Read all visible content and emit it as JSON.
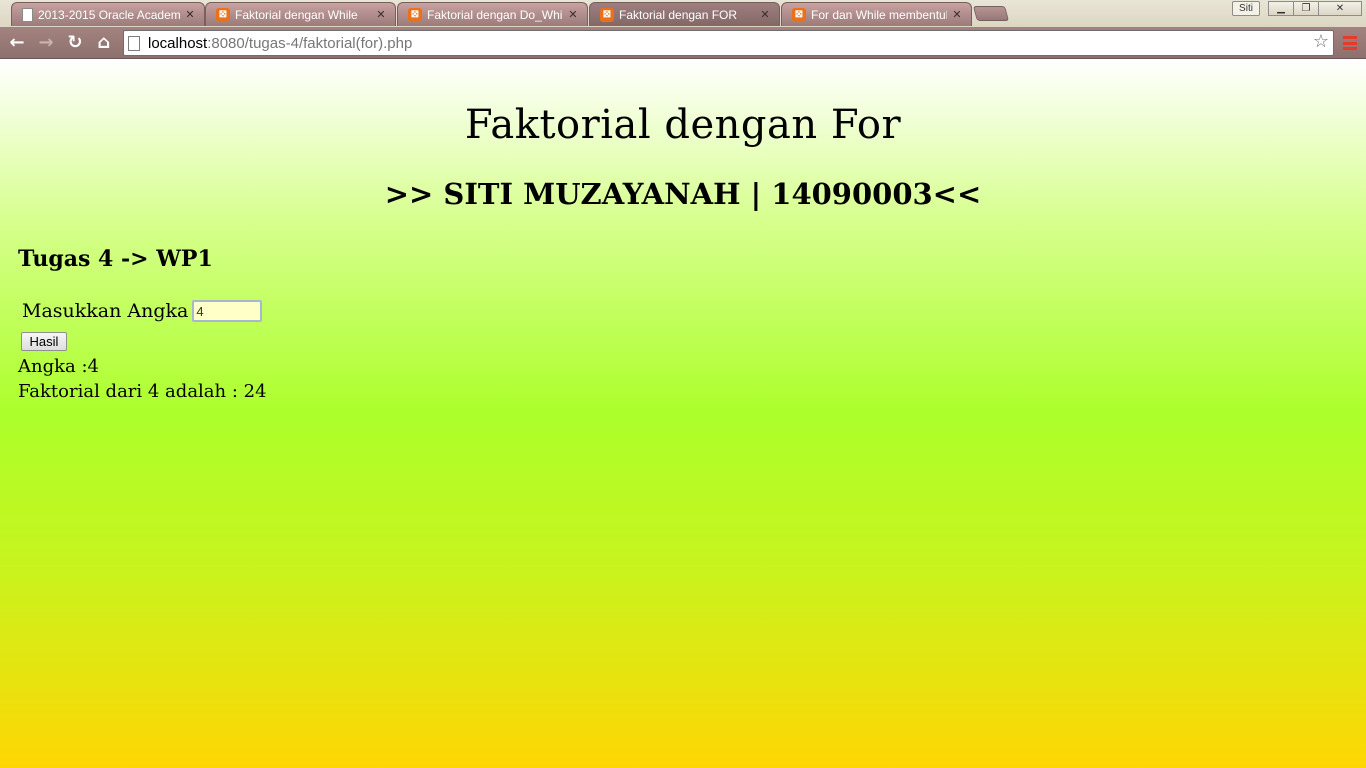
{
  "browser": {
    "tabs": [
      {
        "title": "2013-2015 Oracle Academ",
        "icon": "document-icon",
        "active": false
      },
      {
        "title": "Faktorial dengan While",
        "icon": "xampp-icon",
        "active": false
      },
      {
        "title": "Faktorial dengan Do_Whil",
        "icon": "xampp-icon",
        "active": false
      },
      {
        "title": "Faktorial dengan FOR",
        "icon": "xampp-icon",
        "active": true
      },
      {
        "title": "For dan While membentul",
        "icon": "xampp-icon",
        "active": false
      }
    ],
    "user_badge": "Siti",
    "url_host": "localhost",
    "url_rest": ":8080/tugas-4/faktorial(for).php"
  },
  "page": {
    "title": "Faktorial dengan For",
    "subtitle": ">> SITI MUZAYANAH | 14090003<<",
    "task_heading": "Tugas 4 -> WP1",
    "form": {
      "label": "Masukkan Angka",
      "input_value": "4",
      "submit_label": "Hasil"
    },
    "result": {
      "angka_line": "Angka :4",
      "faktorial_line": "Faktorial dari 4 adalah : 24"
    }
  },
  "colors": {
    "gradient_top": "#ffffff",
    "gradient_mid": "#acff2a",
    "gradient_bottom": "#ffd603",
    "input_background": "#ffffc8",
    "menu_accent": "#e63a2b"
  }
}
